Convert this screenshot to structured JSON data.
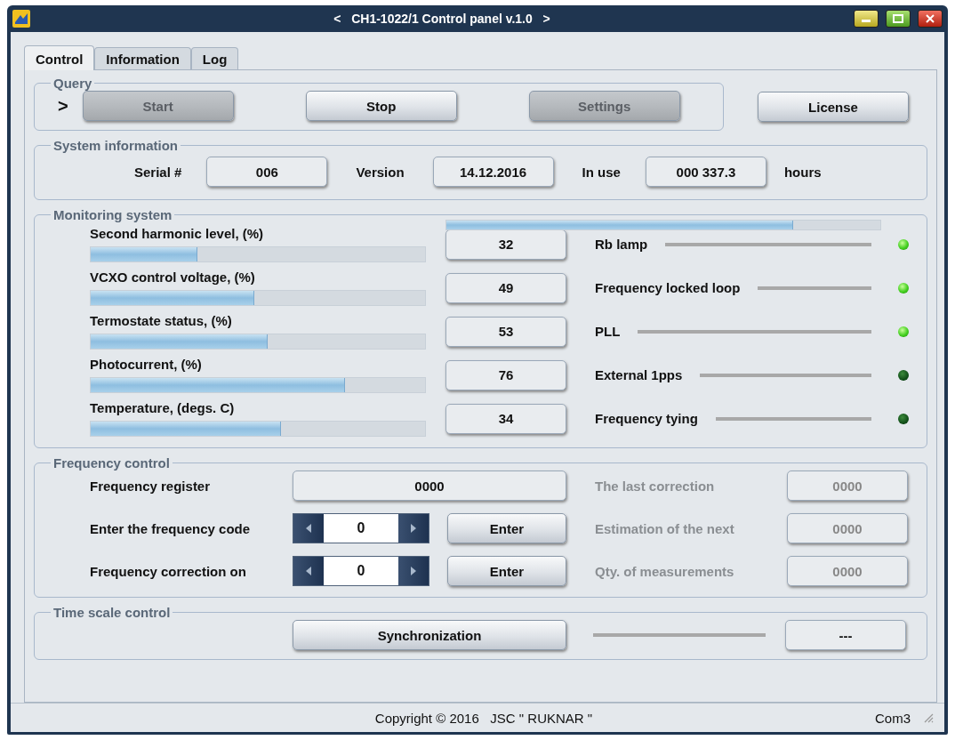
{
  "window": {
    "title": "<   CH1-1022/1 Control panel v.1.0   >"
  },
  "tabs": [
    {
      "label": "Control",
      "selected": true
    },
    {
      "label": "Information",
      "selected": false
    },
    {
      "label": "Log",
      "selected": false
    }
  ],
  "query": {
    "title": "Query",
    "prompt": ">",
    "buttons": [
      {
        "label": "Start",
        "disabled": true
      },
      {
        "label": "Stop",
        "disabled": false
      },
      {
        "label": "Settings",
        "disabled": true
      }
    ]
  },
  "license_button": {
    "label": "License",
    "disabled": false
  },
  "system_information": {
    "title": "System information",
    "fields": [
      {
        "label": "Serial #",
        "value": "006"
      },
      {
        "label": "Version",
        "value": "14.12.2016"
      },
      {
        "label": "In use",
        "value": "000 337.3"
      }
    ],
    "unit": "hours"
  },
  "monitoring": {
    "title": "Monitoring system",
    "level": 0.8,
    "meters": [
      {
        "label": "Second harmonic level, (%)",
        "level": 0.32,
        "value": "32"
      },
      {
        "label": "VCXO control voltage, (%)",
        "level": 0.49,
        "value": "49"
      },
      {
        "label": "Termostate status, (%)",
        "level": 0.53,
        "value": "53"
      },
      {
        "label": "Photocurrent, (%)",
        "level": 0.76,
        "value": "76"
      },
      {
        "label": "Temperature,  (degs. C)",
        "level": 0.57,
        "value": "34"
      }
    ],
    "indicators": [
      {
        "label": "Rb lamp",
        "on": true
      },
      {
        "label": "Frequency locked loop",
        "on": true
      },
      {
        "label": "PLL",
        "on": true
      },
      {
        "label": "External 1pps",
        "on": false
      },
      {
        "label": "Frequency tying",
        "on": false
      }
    ]
  },
  "frequency_control": {
    "title": "Frequency control",
    "register": {
      "label": "Frequency register",
      "value": "0000"
    },
    "inputs": [
      {
        "label": "Enter the frequency code",
        "value": "0",
        "button": "Enter"
      },
      {
        "label": "Frequency correction on",
        "value": "0",
        "button": "Enter"
      }
    ],
    "readouts": [
      {
        "label": "The last correction",
        "value": "0000",
        "disabled": true
      },
      {
        "label": "Estimation of the next",
        "value": "0000",
        "disabled": true
      },
      {
        "label": "Qty. of measurements",
        "value": "0000",
        "disabled": true
      }
    ]
  },
  "time_scale_control": {
    "title": "Time scale control",
    "button": "Synchronization",
    "value": "---"
  },
  "status_bar": {
    "copyright": "Copyright © 2016   JSC \" RUKNAR \"",
    "port": "Com3"
  }
}
